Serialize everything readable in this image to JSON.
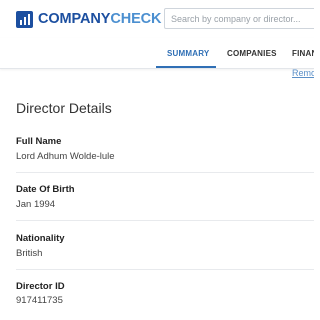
{
  "header": {
    "logo": {
      "part1": "COMPANY",
      "part2": "CHECK"
    },
    "search": {
      "placeholder": "Search by company or director...",
      "value": ""
    }
  },
  "tabs": [
    {
      "label": "SUMMARY",
      "active": true
    },
    {
      "label": "COMPANIES",
      "active": false
    },
    {
      "label": "FINAN",
      "active": false
    }
  ],
  "remove_link": "Remo",
  "section": {
    "title": "Director Details",
    "fields": [
      {
        "label": "Full Name",
        "value": "Lord Adhum Wolde-lule"
      },
      {
        "label": "Date Of Birth",
        "value": "Jan 1994"
      },
      {
        "label": "Nationality",
        "value": "British"
      },
      {
        "label": "Director ID",
        "value": "917411735"
      }
    ]
  },
  "colors": {
    "brand_dark": "#1c4fa0",
    "brand_light": "#4b8fd0",
    "active_tab": "#2f6fb5"
  }
}
